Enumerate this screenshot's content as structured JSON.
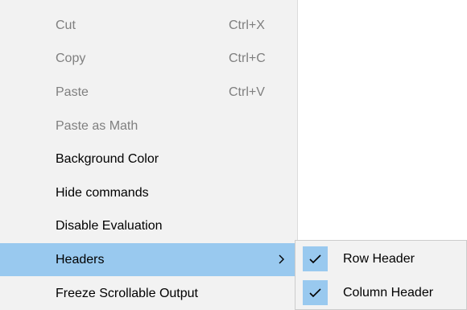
{
  "context_menu": {
    "items": [
      {
        "label": "Cut",
        "shortcut": "Ctrl+X",
        "enabled": false
      },
      {
        "label": "Copy",
        "shortcut": "Ctrl+C",
        "enabled": false
      },
      {
        "label": "Paste",
        "shortcut": "Ctrl+V",
        "enabled": false
      },
      {
        "label": "Paste as Math",
        "shortcut": "",
        "enabled": false
      },
      {
        "label": "Background Color",
        "shortcut": "",
        "enabled": true
      },
      {
        "label": "Hide commands",
        "shortcut": "",
        "enabled": true
      },
      {
        "label": "Disable Evaluation",
        "shortcut": "",
        "enabled": true
      },
      {
        "label": "Headers",
        "shortcut": "",
        "enabled": true,
        "highlighted": true,
        "has_submenu": true
      },
      {
        "label": "Freeze Scrollable Output",
        "shortcut": "",
        "enabled": true
      }
    ]
  },
  "headers_submenu": {
    "items": [
      {
        "label": "Row Header",
        "checked": true
      },
      {
        "label": "Column Header",
        "checked": true
      }
    ]
  },
  "icons": {
    "submenu_arrow": "chevron-right-icon",
    "check": "checkmark-icon"
  },
  "colors": {
    "menu_background": "#f2f2f2",
    "highlight": "#99c9ef",
    "disabled_text": "#7f7f7f"
  }
}
